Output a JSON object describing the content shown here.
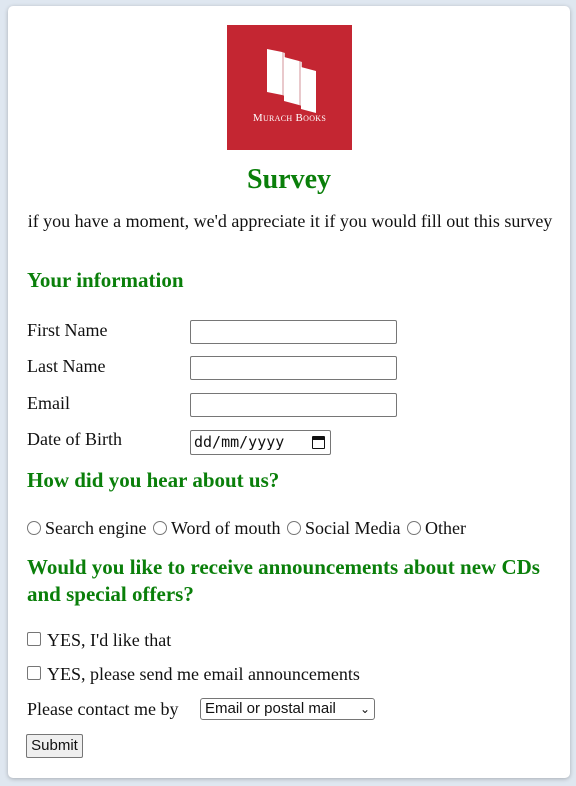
{
  "logo": {
    "text": "Murach Books",
    "bg_color": "#c42632"
  },
  "title": "Survey",
  "intro": "if you have a moment, we'd appreciate it if you would fill out this survey",
  "section_info": {
    "heading": "Your information",
    "first_name_label": "First Name",
    "last_name_label": "Last Name",
    "email_label": "Email",
    "dob_label": "Date of Birth",
    "dob_placeholder": "dd/mm/yyyy",
    "first_name_value": "",
    "last_name_value": "",
    "email_value": ""
  },
  "section_heard": {
    "heading": "How did you hear about us?",
    "options": [
      "Search engine",
      "Word of mouth",
      "Social Media",
      "Other"
    ]
  },
  "section_announce": {
    "heading": "Would you like to receive announcements about new CDs and special offers?",
    "check1": "YES, I'd like that",
    "check2": "YES, please send me email announcements",
    "contact_label": "Please contact me by",
    "contact_selected": "Email or postal mail"
  },
  "submit_label": "Submit",
  "colors": {
    "heading": "#0a7f0a",
    "background": "#dfe7f0"
  }
}
